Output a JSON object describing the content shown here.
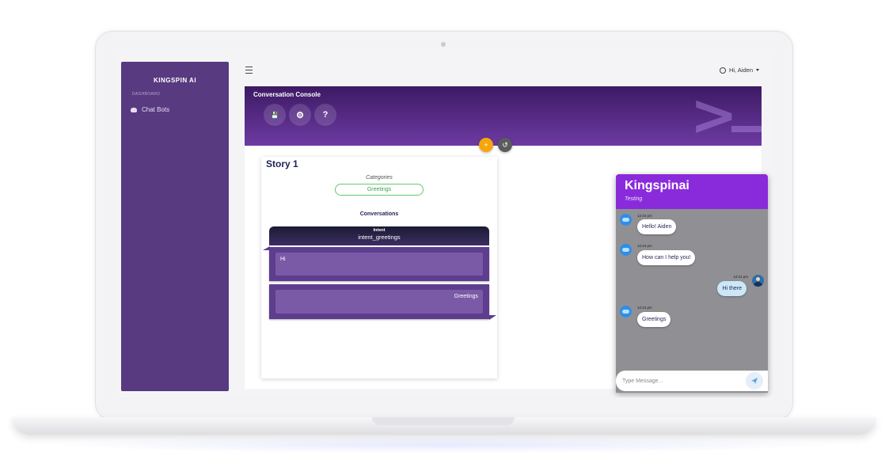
{
  "sidebar": {
    "brand": "KINGSPIN AI",
    "section_label": "DASHBOARD",
    "items": [
      {
        "label": "Chat Bots",
        "icon": "robot-icon"
      }
    ]
  },
  "topbar": {
    "user_label": "Hi, Aiden"
  },
  "console": {
    "title": "Conversation Console",
    "buttons": [
      {
        "icon": "save-icon",
        "glyph": "💾"
      },
      {
        "icon": "settings-icon",
        "glyph": "⚙"
      },
      {
        "icon": "help-icon",
        "glyph": "?"
      }
    ],
    "add_glyph": "+",
    "undo_glyph": "↺"
  },
  "story": {
    "title": "Story 1",
    "categories_label": "Categories",
    "category": "Greetings",
    "conversations_label": "Conversations",
    "intent_key": "Intent",
    "intent_value": "intent_greetings",
    "messages": [
      "Hi",
      "Greetings"
    ]
  },
  "chat": {
    "bot_name": "Kingspinai",
    "status": "Testing",
    "messages": [
      {
        "from": "bot",
        "time": "12:24 pm",
        "text": "Hello! Aiden"
      },
      {
        "from": "bot",
        "time": "12:24 pm",
        "text": "How can I help you!"
      },
      {
        "from": "user",
        "time": "12:24 pm",
        "text": "Hi there"
      },
      {
        "from": "bot",
        "time": "12:24 pm",
        "text": "Greetings"
      }
    ],
    "input_placeholder": "Type Message..."
  },
  "colors": {
    "sidebar": "#573a80",
    "header_gradient": [
      "#3c1a64",
      "#6d3aa2"
    ],
    "chat_header": "#8a2bdb",
    "accent_add": "#f5a60b",
    "category_pill": "#62c96e"
  }
}
